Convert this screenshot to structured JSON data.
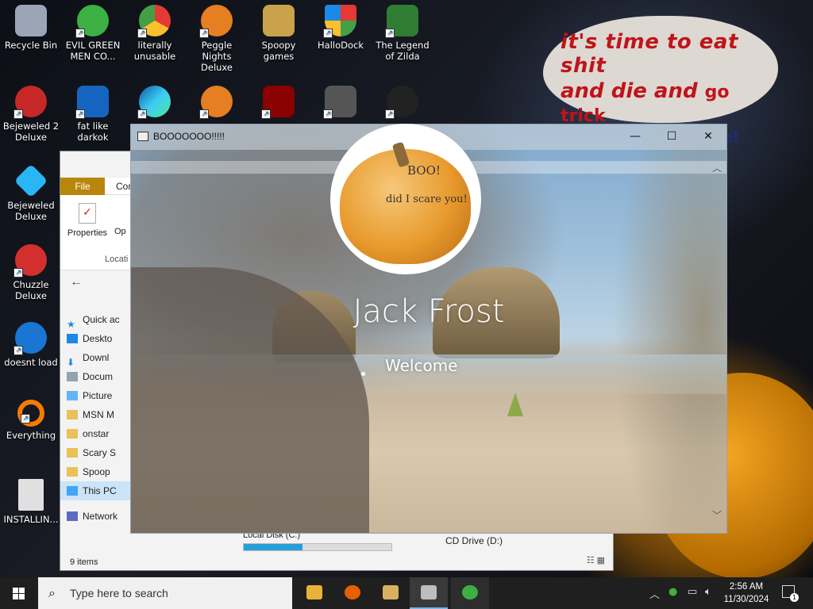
{
  "desktop": {
    "bubble": {
      "line1": "it's time to eat shit",
      "line2a": "and die and",
      "line2b": "go trick",
      "line3": "or treating and vote!"
    },
    "icons": [
      {
        "label": "Recycle Bin",
        "icon": "recycle-bin-icon",
        "color": "#9aa6b8"
      },
      {
        "label": "EVIL GREEN MEN CO...",
        "icon": "green-men-icon",
        "color": "#3cb043"
      },
      {
        "label": "literally unusable",
        "icon": "chrome-icon",
        "color": "#e53935"
      },
      {
        "label": "Peggle Nights Deluxe",
        "icon": "peggle-icon",
        "color": "#e67e22"
      },
      {
        "label": "Spoopy games",
        "icon": "folder-icon",
        "color": "#c9a24b"
      },
      {
        "label": "HalloDock",
        "icon": "windows-shield-icon",
        "color": "#1e88e5"
      },
      {
        "label": "The Legend of Zilda",
        "icon": "zelda-icon",
        "color": "#2e7d32"
      },
      {
        "label": "Bejeweled 2 Deluxe",
        "icon": "bejeweled2-icon",
        "color": "#c62828"
      },
      {
        "label": "fat like darkok",
        "icon": "mpl-icon",
        "color": "#1565c0"
      },
      {
        "label": "Bejeweled Deluxe",
        "icon": "bejeweled-icon",
        "color": "#29b6f6"
      },
      {
        "label": "Chuzzle Deluxe",
        "icon": "chuzzle-icon",
        "color": "#d32f2f"
      },
      {
        "label": "doesnt load",
        "icon": "thunderbird-icon",
        "color": "#1976d2"
      },
      {
        "label": "Everything",
        "icon": "everything-icon",
        "color": "#f57c00"
      },
      {
        "label": "INSTALLIN...",
        "icon": "text-file-icon",
        "color": "#e0e0e0"
      }
    ]
  },
  "explorer": {
    "file_tab": "File",
    "com_tab": "Com",
    "properties": "Properties",
    "open": "Op",
    "location": "Locati",
    "tree": [
      "Quick ac",
      "Deskto",
      "Downl",
      "Docum",
      "Picture",
      "MSN M",
      "onstar",
      "Scary S",
      "Spoop",
      "This PC",
      "Network"
    ],
    "local_disk": "Local Disk (C:)",
    "cd_drive": "CD Drive (D:)",
    "disk_used_pct": 40,
    "status": "9 items"
  },
  "lockwin": {
    "title": "BOOOOOOO!!!!!",
    "minimize": "—",
    "maximize": "☐",
    "close": "✕",
    "avatar_boo": "BOO!",
    "avatar_scare": "did I scare you!",
    "username": "Jack Frost",
    "welcome": "Welcome"
  },
  "taskbar": {
    "search_placeholder": "Type here to search",
    "time": "2:56 AM",
    "date": "11/30/2024",
    "notifications": "1",
    "pinned": [
      {
        "icon": "file-explorer-icon",
        "color": "#e8b23a"
      },
      {
        "icon": "firefox-icon",
        "color": "#e66000"
      },
      {
        "icon": "folder-app-icon",
        "color": "#d8b060"
      },
      {
        "icon": "window-app-icon",
        "color": "#bdbdbd"
      },
      {
        "icon": "green-men-icon",
        "color": "#3cb043"
      }
    ]
  }
}
